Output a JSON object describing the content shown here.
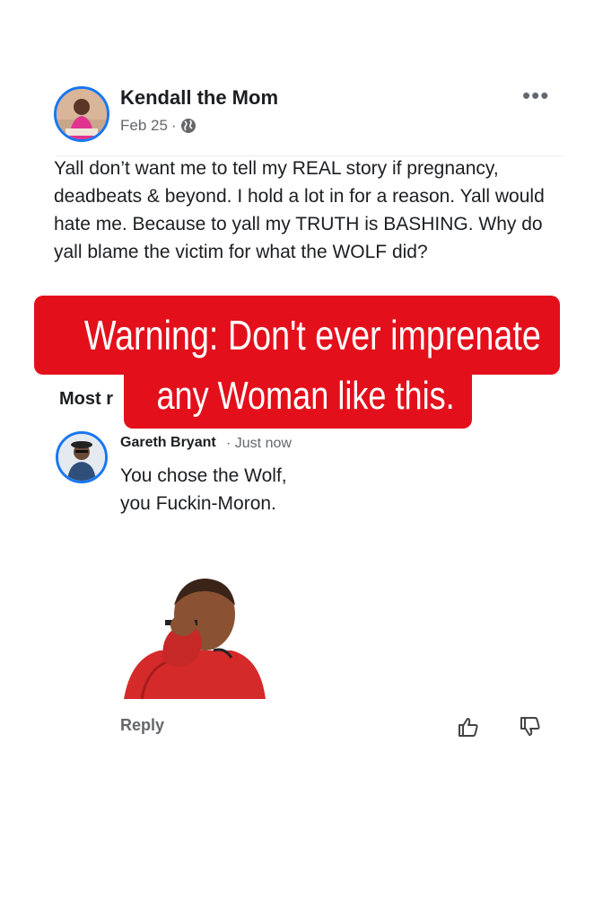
{
  "post": {
    "author": "Kendall the Mom",
    "date": "Feb 25",
    "separator": "·",
    "privacy_icon": "globe-icon",
    "more_icon": "more-dots-icon",
    "more_label": "•••",
    "text": "Yall don’t want me to tell my REAL story if pregnancy, deadbeats & beyond. I hold a lot in for a reason. Yall would hate me. Because to yall my TRUTH is BASHING. Why do yall blame the victim for what the WOLF did?"
  },
  "comments_sort": {
    "label": "Most r"
  },
  "banner": {
    "line1": "Warning: Don't ever imprenate",
    "line2": "any Woman like this.",
    "color": "#e3101c"
  },
  "comment": {
    "author": "Gareth Bryant",
    "time": "· Just now",
    "line1": "You chose the Wolf,",
    "line2": "you Fuckin-Moron."
  },
  "actions": {
    "reply_label": "Reply",
    "like_icon": "thumbs-up-icon",
    "dislike_icon": "thumbs-down-icon"
  },
  "colors": {
    "accent": "#1877f2",
    "muted": "#65676b"
  }
}
